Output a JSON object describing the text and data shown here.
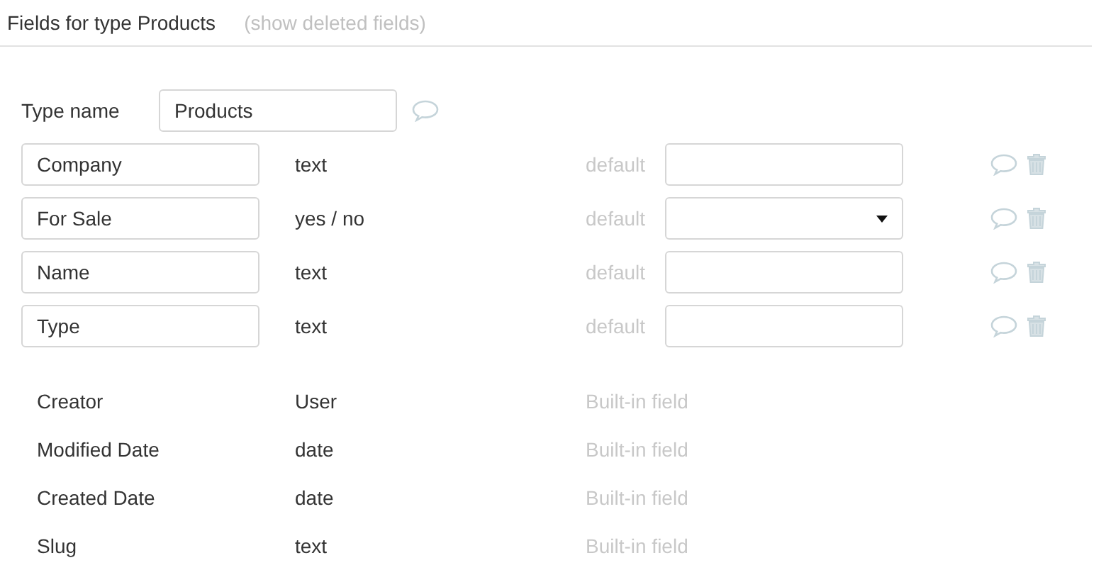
{
  "header": {
    "title": "Fields for type Products",
    "link": "(show deleted fields)"
  },
  "type_name": {
    "label": "Type name",
    "value": "Products"
  },
  "fields": [
    {
      "kind": "custom",
      "name": "Company",
      "type": "text",
      "default_label": "default",
      "default_dropdown": false
    },
    {
      "kind": "custom",
      "name": "For Sale",
      "type": "yes / no",
      "default_label": "default",
      "default_dropdown": true
    },
    {
      "kind": "custom",
      "name": "Name",
      "type": "text",
      "default_label": "default",
      "default_dropdown": false
    },
    {
      "kind": "custom",
      "name": "Type",
      "type": "text",
      "default_label": "default",
      "default_dropdown": false
    },
    {
      "kind": "builtin",
      "name": "Creator",
      "type": "User",
      "note": "Built-in field"
    },
    {
      "kind": "builtin",
      "name": "Modified Date",
      "type": "date",
      "note": "Built-in field"
    },
    {
      "kind": "builtin",
      "name": "Created Date",
      "type": "date",
      "note": "Built-in field"
    },
    {
      "kind": "builtin",
      "name": "Slug",
      "type": "text",
      "note": "Built-in field"
    }
  ]
}
